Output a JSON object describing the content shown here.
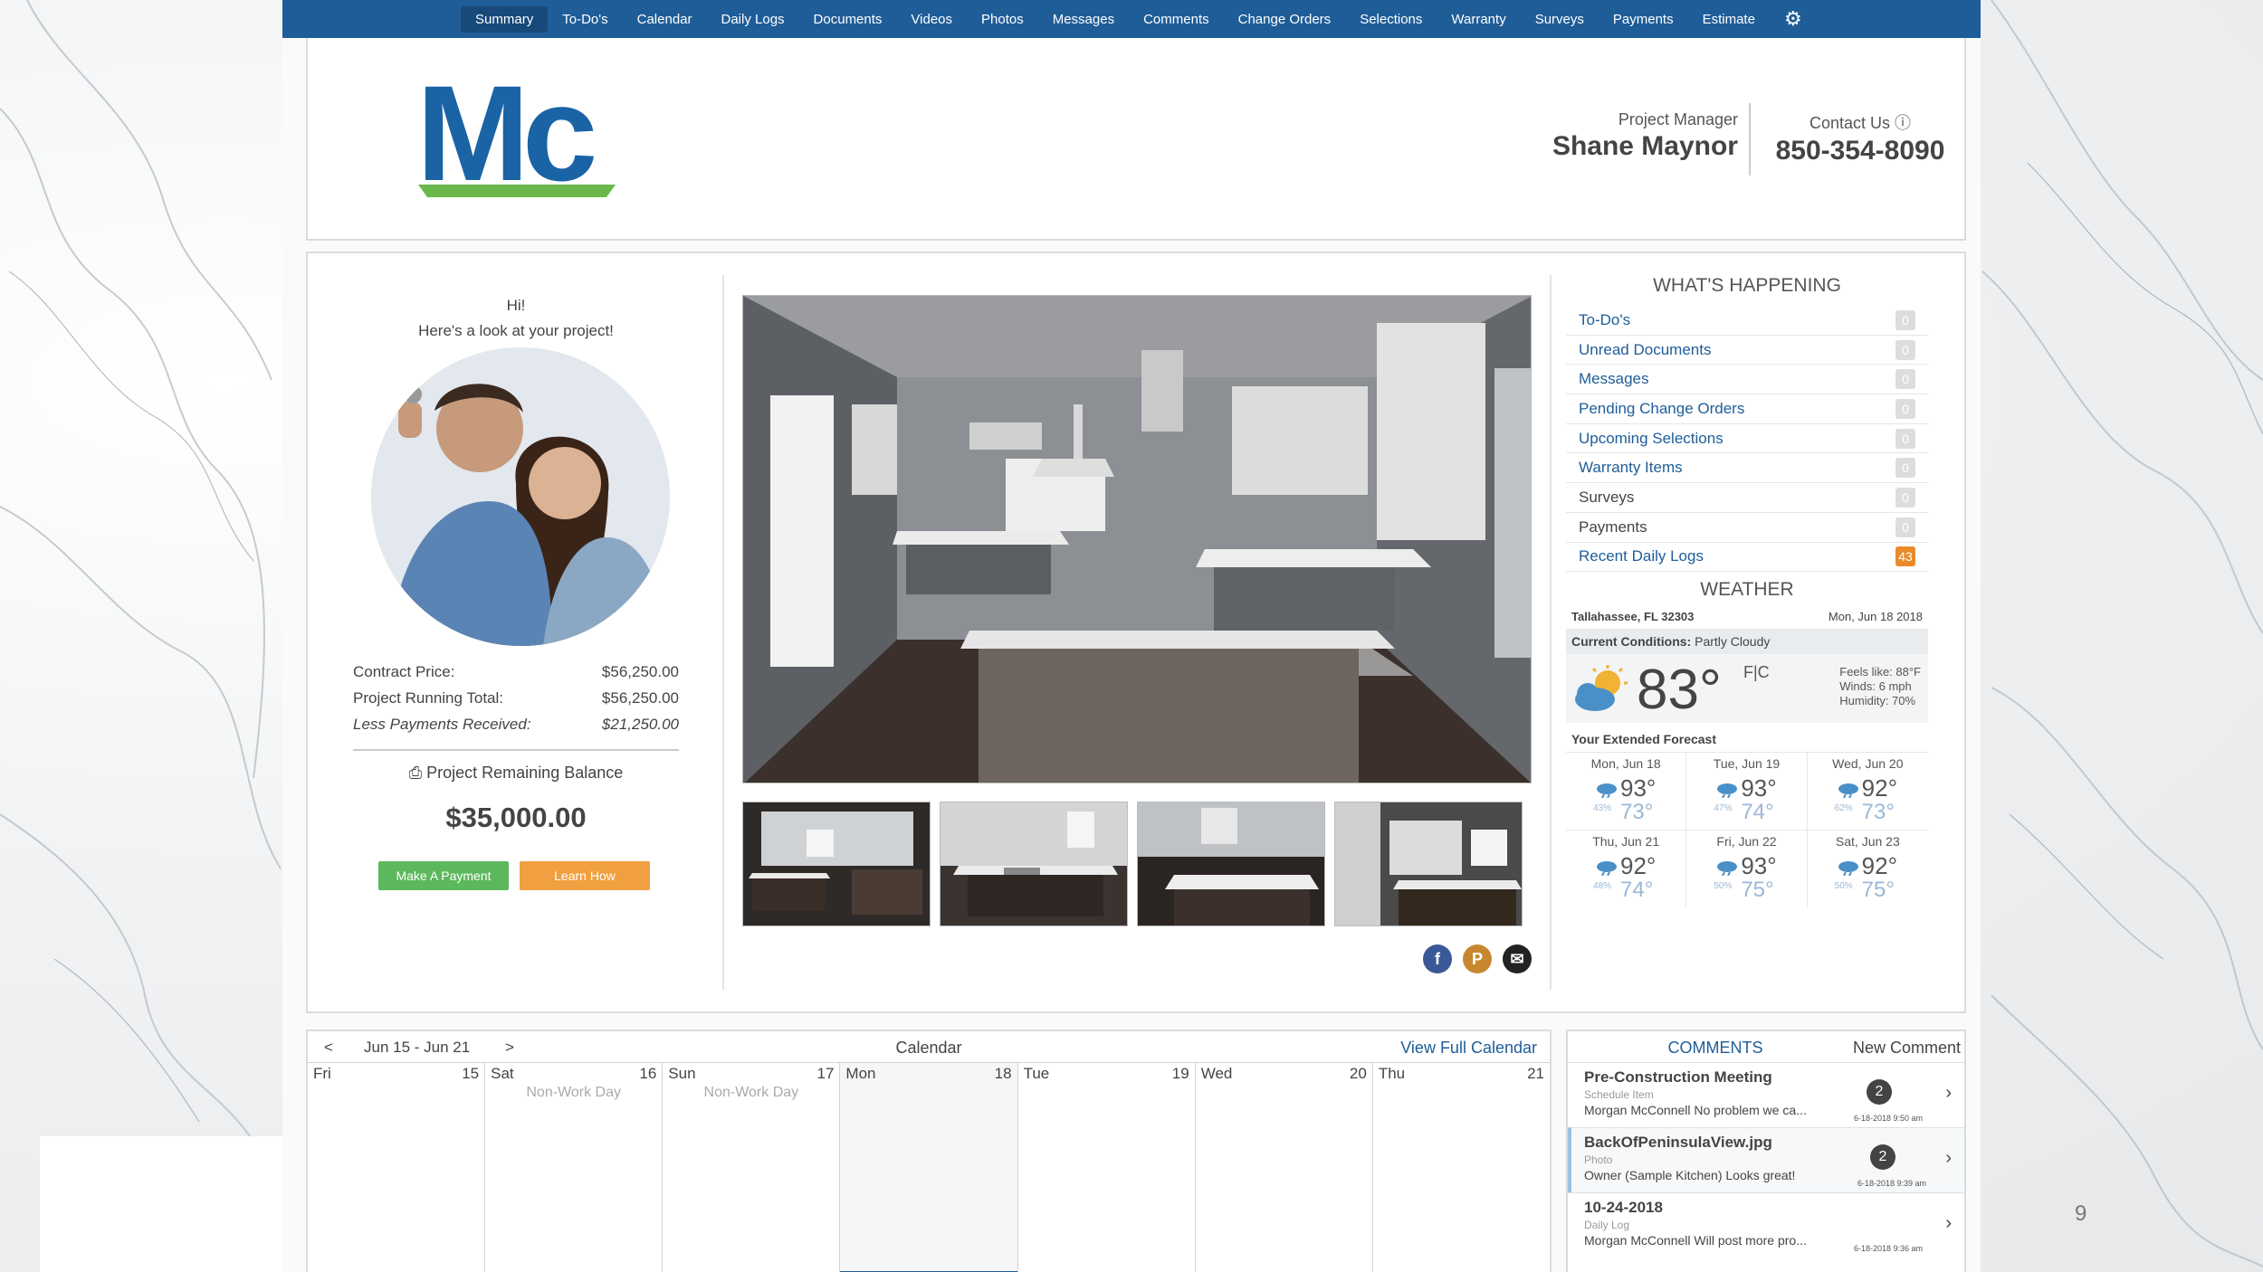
{
  "nav": {
    "items": [
      "Summary",
      "To-Do's",
      "Calendar",
      "Daily Logs",
      "Documents",
      "Videos",
      "Photos",
      "Messages",
      "Comments",
      "Change Orders",
      "Selections",
      "Warranty",
      "Surveys",
      "Payments",
      "Estimate"
    ],
    "active": "Summary",
    "gear_icon": "gear-icon"
  },
  "header": {
    "logo_text": "Mc",
    "pm_label": "Project Manager",
    "pm_name": "Shane Maynor",
    "contact_label": "Contact Us ⓘ",
    "contact_phone": "850-354-8090"
  },
  "summary": {
    "greeting": "Hi!",
    "subgreeting": "Here's a look at your project!",
    "contract_price_label": "Contract Price:",
    "contract_price": "$56,250.00",
    "running_total_label": "Project Running Total:",
    "running_total": "$56,250.00",
    "payments_label": "Less Payments Received:",
    "payments": "$21,250.00",
    "remaining_label": "Project Remaining Balance",
    "remaining_amount": "$35,000.00",
    "pay_button": "Make A Payment",
    "learn_button": "Learn How"
  },
  "happening": {
    "title": "WHAT'S HAPPENING",
    "items": [
      {
        "label": "To-Do's",
        "count": "0"
      },
      {
        "label": "Unread Documents",
        "count": "0"
      },
      {
        "label": "Messages",
        "count": "0"
      },
      {
        "label": "Pending Change Orders",
        "count": "0"
      },
      {
        "label": "Upcoming Selections",
        "count": "0"
      },
      {
        "label": "Warranty Items",
        "count": "0"
      },
      {
        "label": "Surveys",
        "count": "0"
      },
      {
        "label": "Payments",
        "count": "0"
      },
      {
        "label": "Recent Daily Logs",
        "count": "43"
      }
    ]
  },
  "weather": {
    "title": "WEATHER",
    "location": "Tallahassee, FL 32303",
    "date": "Mon, Jun 18 2018",
    "conditions_label": "Current Conditions:",
    "conditions": "Partly Cloudy",
    "temp": "83°",
    "unit": "F|C",
    "feels": "Feels like: 88°F",
    "winds": "Winds: 6 mph",
    "humidity": "Humidity: 70%",
    "extended_label": "Your Extended Forecast",
    "forecast": [
      {
        "day": "Mon, Jun 18",
        "hi": "93°",
        "lo": "73°",
        "pct": "43%"
      },
      {
        "day": "Tue, Jun 19",
        "hi": "93°",
        "lo": "74°",
        "pct": "47%"
      },
      {
        "day": "Wed, Jun 20",
        "hi": "92°",
        "lo": "73°",
        "pct": "62%"
      },
      {
        "day": "Thu, Jun 21",
        "hi": "92°",
        "lo": "74°",
        "pct": "48%"
      },
      {
        "day": "Fri, Jun 22",
        "hi": "93°",
        "lo": "75°",
        "pct": "50%"
      },
      {
        "day": "Sat, Jun 23",
        "hi": "92°",
        "lo": "75°",
        "pct": "50%"
      }
    ]
  },
  "calendar": {
    "prev": "<",
    "next": ">",
    "range": "Jun 15 - Jun 21",
    "title": "Calendar",
    "view_full": "View Full Calendar",
    "days": [
      {
        "name": "Fri",
        "num": "15",
        "note": ""
      },
      {
        "name": "Sat",
        "num": "16",
        "note": "Non-Work Day"
      },
      {
        "name": "Sun",
        "num": "17",
        "note": "Non-Work Day"
      },
      {
        "name": "Mon",
        "num": "18",
        "note": ""
      },
      {
        "name": "Tue",
        "num": "19",
        "note": ""
      },
      {
        "name": "Wed",
        "num": "20",
        "note": ""
      },
      {
        "name": "Thu",
        "num": "21",
        "note": ""
      }
    ]
  },
  "comments": {
    "title": "COMMENTS",
    "new_label": "New Comment",
    "items": [
      {
        "title": "Pre-Construction Meeting",
        "type": "Schedule Item",
        "body": "Morgan McConnell No problem we ca...",
        "count": "2",
        "date": "6-18-2018 9:50 am"
      },
      {
        "title": "BackOfPeninsulaView.jpg",
        "type": "Photo",
        "body": "Owner (Sample Kitchen) Looks great!",
        "count": "2",
        "date": "6-18-2018 9:39 am"
      },
      {
        "title": "10-24-2018",
        "type": "Daily Log",
        "body": "Morgan McConnell Will post more pro...",
        "count": "",
        "date": "6-18-2018 9:36 am"
      }
    ]
  },
  "social": [
    "facebook-icon",
    "pinterest-icon",
    "email-icon"
  ],
  "page_number": "9",
  "colors": {
    "nav": "#1f5d99",
    "green": "#5cb85c",
    "orange": "#f0a040",
    "badge_orange": "#e98b2a"
  }
}
